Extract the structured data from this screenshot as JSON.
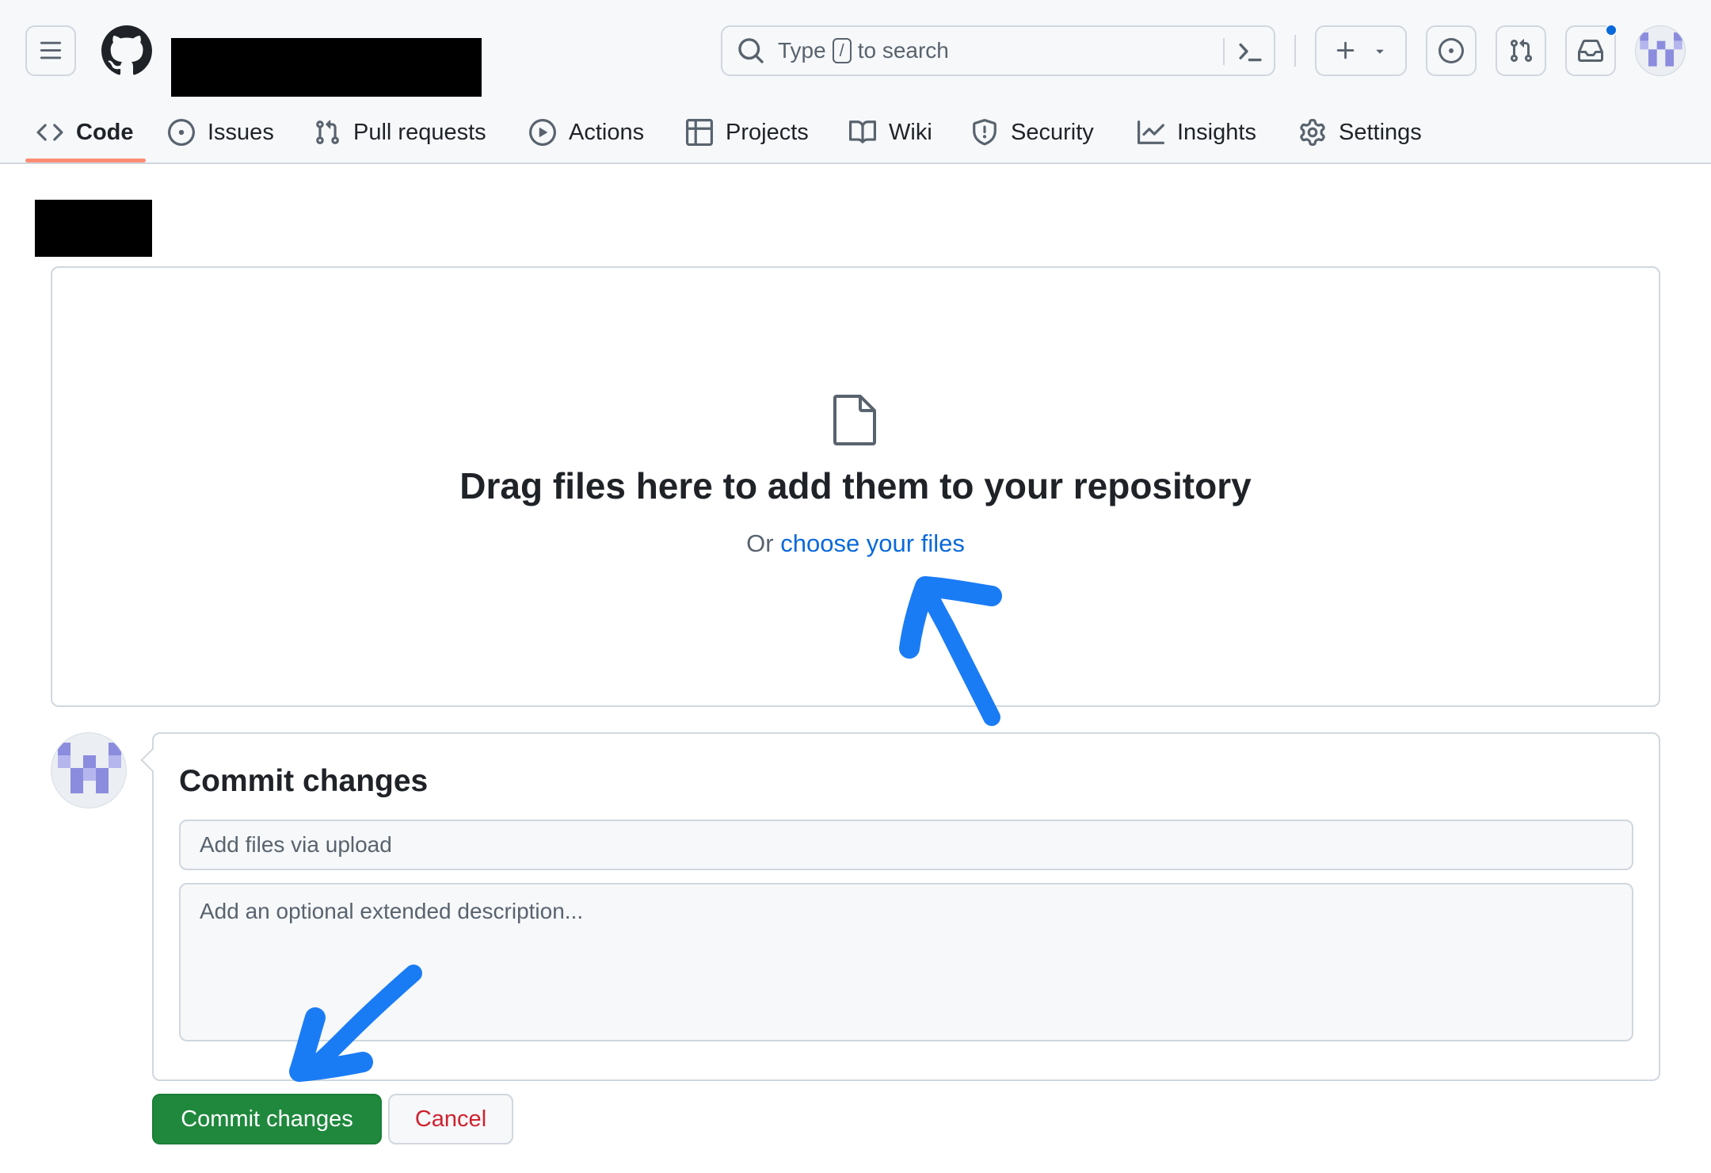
{
  "header": {
    "search": {
      "prefix": "Type",
      "key": "/",
      "suffix": "to search"
    }
  },
  "nav": {
    "tabs": [
      {
        "label": "Code",
        "icon": "code-icon",
        "active": true
      },
      {
        "label": "Issues",
        "icon": "issue-opened-icon"
      },
      {
        "label": "Pull requests",
        "icon": "git-pull-request-icon"
      },
      {
        "label": "Actions",
        "icon": "play-icon"
      },
      {
        "label": "Projects",
        "icon": "table-icon"
      },
      {
        "label": "Wiki",
        "icon": "book-icon"
      },
      {
        "label": "Security",
        "icon": "shield-icon"
      },
      {
        "label": "Insights",
        "icon": "graph-icon"
      },
      {
        "label": "Settings",
        "icon": "gear-icon"
      }
    ]
  },
  "upload": {
    "title": "Drag files here to add them to your repository",
    "or_text": "Or",
    "choose_link": "choose your files"
  },
  "commit": {
    "title": "Commit changes",
    "summary_placeholder": "Add files via upload",
    "description_placeholder": "Add an optional extended description...",
    "commit_button": "Commit changes",
    "cancel_button": "Cancel"
  },
  "colors": {
    "accent": "#0969da",
    "primary_button": "#1f883d",
    "danger": "#cf222e",
    "active_tab_underline": "#fd8c73",
    "annotation_arrow": "#1a7cf5",
    "avatar_identicon": "#8b8cde"
  }
}
